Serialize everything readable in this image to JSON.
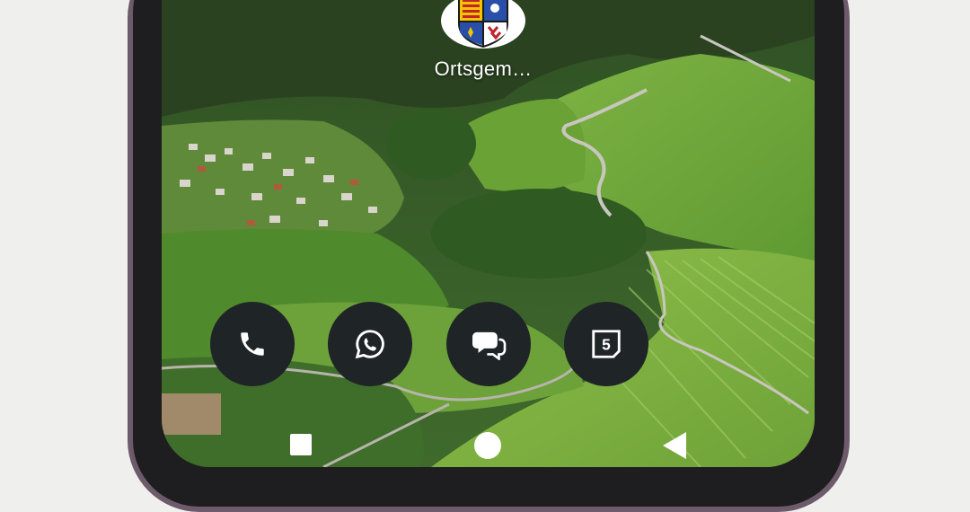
{
  "home_screen": {
    "app_label": "Ortsgem…",
    "app_icon": "coat-of-arms-icon"
  },
  "dock": [
    {
      "name": "phone",
      "icon": "phone-icon"
    },
    {
      "name": "whatsapp",
      "icon": "whatsapp-icon"
    },
    {
      "name": "messages",
      "icon": "chat-bubble-icon"
    },
    {
      "name": "calendar",
      "icon": "calendar-icon",
      "text": "5"
    }
  ],
  "nav_bar": {
    "recents": "square-icon",
    "home": "circle-icon",
    "back": "triangle-back-icon"
  },
  "colors": {
    "frame": "#6d5a6a",
    "bezel": "#1e1e20",
    "dock_button": "#1f2427",
    "background": "#efefed"
  }
}
